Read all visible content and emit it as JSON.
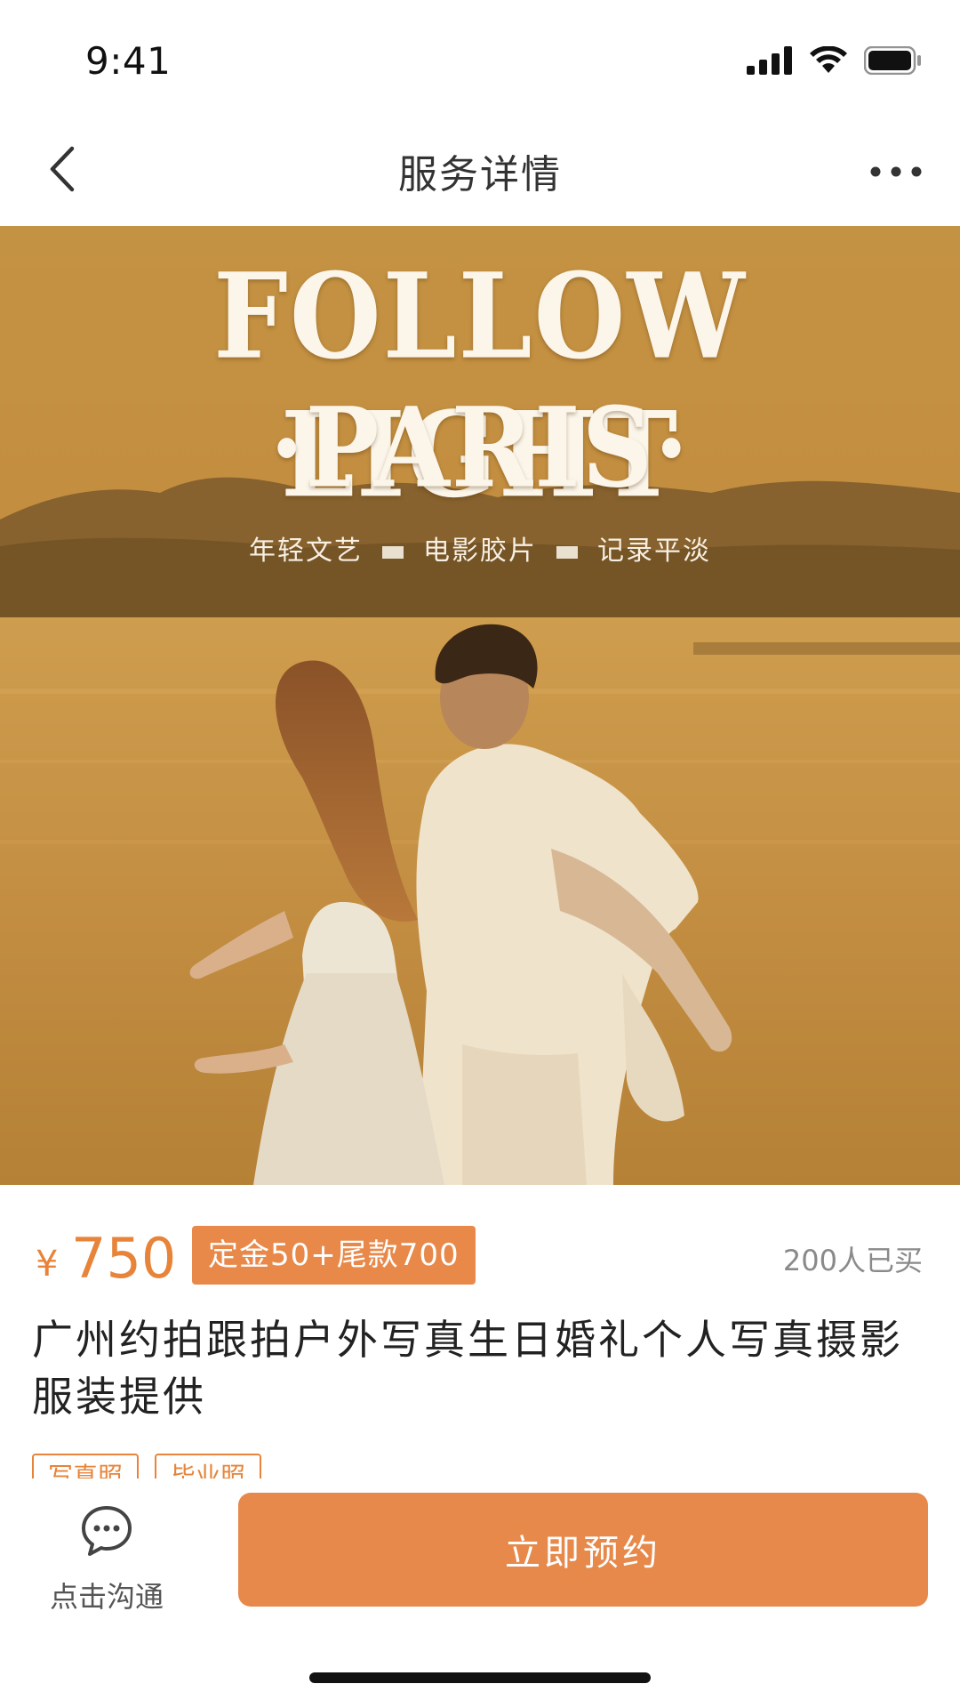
{
  "status_bar": {
    "time": "9:41",
    "icons": [
      "signal-icon",
      "wifi-icon",
      "battery-icon"
    ]
  },
  "nav": {
    "title": "服务详情",
    "back_icon": "chevron-left-icon",
    "more_icon": "more-dots-icon"
  },
  "hero": {
    "title_line1": "FOLLOW LIGHT",
    "title_line2": "·PARIS·",
    "taglines": [
      "年轻文艺",
      "电影胶片",
      "记录平淡"
    ]
  },
  "price": {
    "symbol": "¥",
    "amount": "750",
    "deposit_badge": "定金50+尾款700",
    "sold": "200人已买"
  },
  "service": {
    "title": "广州约拍跟拍户外写真生日婚礼个人写真摄影服装提供",
    "tags": [
      "写真照",
      "毕业照"
    ]
  },
  "bottom_bar": {
    "chat_label": "点击沟通",
    "book_label": "立即预约"
  },
  "colors": {
    "accent": "#e7843a",
    "button": "#e7894a",
    "hero_tone": "#c08a3a"
  }
}
